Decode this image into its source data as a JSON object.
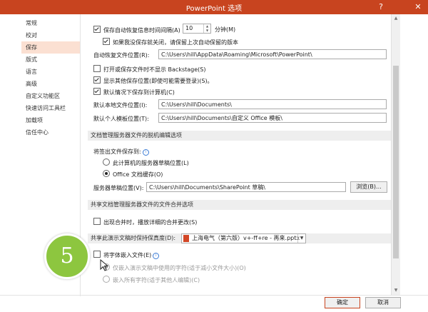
{
  "window": {
    "title": "PowerPoint 选项",
    "help_label": "?",
    "close_label": "✕"
  },
  "sidebar": {
    "items": [
      {
        "label": "常规"
      },
      {
        "label": "校对"
      },
      {
        "label": "保存",
        "active": true
      },
      {
        "label": "版式"
      },
      {
        "label": "语言"
      },
      {
        "label": "高级"
      },
      {
        "label": "自定义功能区"
      },
      {
        "label": "快速访问工具栏"
      },
      {
        "label": "加载项"
      },
      {
        "label": "信任中心"
      }
    ]
  },
  "save": {
    "autosave_label": "保存自动恢复信息时间间隔(A)",
    "autosave_minutes": "10",
    "minutes_label": "分钟(M)",
    "keep_last_label": "如果我没保存就关闭，请保留上次自动保留的版本",
    "autorecover_loc_label": "自动恢复文件位置(R):",
    "autorecover_loc_value": "C:\\Users\\hill\\AppData\\Roaming\\Microsoft\\PowerPoint\\",
    "no_backstage_label": "打开或保存文件时不显示 Backstage(S)",
    "show_other_label": "显示其他保存位置(即使可能需要登录)(S)。",
    "default_computer_label": "默认情况下保存到计算机(C)",
    "local_loc_label": "默认本地文件位置(I):",
    "local_loc_value": "C:\\Users\\hill\\Documents\\",
    "templates_loc_label": "默认个人模板位置(T):",
    "templates_loc_value": "C:\\Users\\hill\\Documents\\自定义 Office 模板\\"
  },
  "offline": {
    "section_title": "文档管理服务器文件的脱机编辑选项",
    "save_checked_out_label": "将签出文件保存到:",
    "server_drafts_option": "此计算机的服务器草稿位置(L)",
    "office_cache_option": "Office 文档缓存(O)",
    "drafts_loc_label": "服务器草稿位置(V):",
    "drafts_loc_value": "C:\\Users\\hill\\Documents\\SharePoint 草稿\\",
    "browse_label": "浏览(B)..."
  },
  "merge": {
    "section_title": "共享文档管理服务器文件的文件合并选项",
    "show_merge_label": "出现合并时，播放详细的合并更改(S)"
  },
  "fidelity": {
    "section_title": "共享此演示文稿时保持保真度(D):",
    "presentation_name": "上海电气（第六版）v+-ff+re - 再来.pptx",
    "embed_fonts_label": "将字体嵌入文件(E)",
    "embed_used_label": "仅嵌入演示文稿中使用的字符(适于减小文件大小)(O)",
    "embed_all_label": "嵌入所有字符(适于其他人编辑)(C)"
  },
  "footer": {
    "ok_label": "确定",
    "cancel_label": "取消"
  },
  "overlay": {
    "step_number": "5"
  },
  "colors": {
    "accent": "#c8441f",
    "badge": "#8dc63f"
  }
}
